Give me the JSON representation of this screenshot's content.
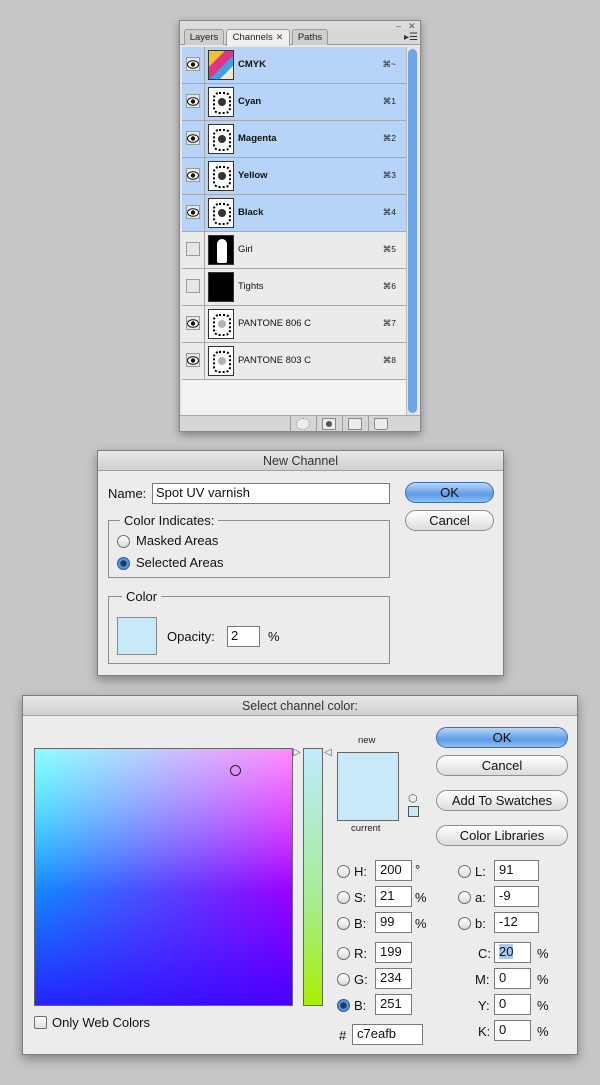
{
  "channels_panel": {
    "tabs": [
      {
        "label": "Layers"
      },
      {
        "label": "Channels"
      },
      {
        "label": "Paths"
      }
    ],
    "close_glyph": "✕",
    "channels": [
      {
        "name": "CMYK",
        "shortcut": "⌘~",
        "visible": true,
        "selected": true
      },
      {
        "name": "Cyan",
        "shortcut": "⌘1",
        "visible": true,
        "selected": true
      },
      {
        "name": "Magenta",
        "shortcut": "⌘2",
        "visible": true,
        "selected": true
      },
      {
        "name": "Yellow",
        "shortcut": "⌘3",
        "visible": true,
        "selected": true
      },
      {
        "name": "Black",
        "shortcut": "⌘4",
        "visible": true,
        "selected": true
      },
      {
        "name": "Girl",
        "shortcut": "⌘5",
        "visible": false,
        "selected": false
      },
      {
        "name": "Tights",
        "shortcut": "⌘6",
        "visible": false,
        "selected": false
      },
      {
        "name": "PANTONE 806 C",
        "shortcut": "⌘7",
        "visible": true,
        "selected": false
      },
      {
        "name": "PANTONE 803 C",
        "shortcut": "⌘8",
        "visible": true,
        "selected": false
      }
    ],
    "footer_icons": [
      "load-channel-as-selection-icon",
      "save-selection-as-channel-icon",
      "new-channel-icon",
      "delete-channel-icon"
    ]
  },
  "new_channel_dialog": {
    "title": "New Channel",
    "name_label": "Name:",
    "name_value": "Spot UV varnish",
    "ok_label": "OK",
    "cancel_label": "Cancel",
    "color_indicates_label": "Color Indicates:",
    "masked_areas_label": "Masked Areas",
    "selected_areas_label": "Selected Areas",
    "selected_option": "selected_areas",
    "color_group_label": "Color",
    "opacity_label": "Opacity:",
    "opacity_value": "2",
    "opacity_unit": "%",
    "swatch_color": "#c7eafb"
  },
  "color_picker": {
    "title": "Select channel color:",
    "new_label": "new",
    "current_label": "current",
    "new_color": "#c7eafb",
    "current_color": "#c7eafb",
    "ok_label": "OK",
    "cancel_label": "Cancel",
    "add_to_swatches_label": "Add To Swatches",
    "color_libraries_label": "Color Libraries",
    "only_web_colors_label": "Only Web Colors",
    "only_web_colors_checked": false,
    "selected_mode": "B_rgb",
    "H": {
      "label": "H:",
      "value": "200",
      "unit": "°"
    },
    "S": {
      "label": "S:",
      "value": "21",
      "unit": "%"
    },
    "Bv": {
      "label": "B:",
      "value": "99",
      "unit": "%"
    },
    "R": {
      "label": "R:",
      "value": "199"
    },
    "G": {
      "label": "G:",
      "value": "234"
    },
    "Bb": {
      "label": "B:",
      "value": "251"
    },
    "L": {
      "label": "L:",
      "value": "91"
    },
    "a": {
      "label": "a:",
      "value": "-9"
    },
    "b": {
      "label": "b:",
      "value": "-12"
    },
    "C": {
      "label": "C:",
      "value": "20",
      "unit": "%"
    },
    "M": {
      "label": "M:",
      "value": "0",
      "unit": "%"
    },
    "Y": {
      "label": "Y:",
      "value": "0",
      "unit": "%"
    },
    "K": {
      "label": "K:",
      "value": "0",
      "unit": "%"
    },
    "hex_label": "#",
    "hex_value": "c7eafb"
  }
}
